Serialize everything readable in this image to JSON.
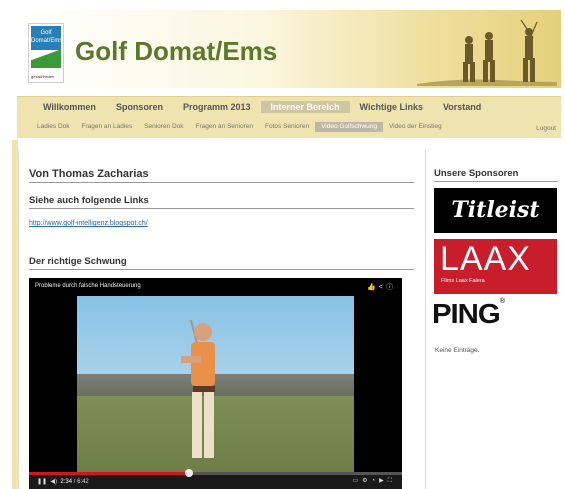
{
  "header": {
    "logo_top": "Golf Domat/Ems",
    "logo_sub": "gesall/Heden",
    "title": "Golf Domat/Ems"
  },
  "nav": {
    "main": [
      {
        "label": "Willkommen",
        "active": false
      },
      {
        "label": "Sponsoren",
        "active": false
      },
      {
        "label": "Programm 2013",
        "active": false
      },
      {
        "label": "Interner Bereich",
        "active": true
      },
      {
        "label": "Wichtige Links",
        "active": false
      },
      {
        "label": "Vorstand",
        "active": false
      }
    ],
    "sub": [
      {
        "label": "Ladies Dok",
        "active": false
      },
      {
        "label": "Fragen an Ladies",
        "active": false
      },
      {
        "label": "Senioren Dok",
        "active": false
      },
      {
        "label": "Fragen an Senioren",
        "active": false
      },
      {
        "label": "Fotos Senioren",
        "active": false
      },
      {
        "label": "Video Golfschwung",
        "active": true
      },
      {
        "label": "Video der Einstieg",
        "active": false
      }
    ],
    "logout": "Logout"
  },
  "main": {
    "heading": "Von Thomas Zacharias",
    "links_heading": "Siehe auch folgende Links",
    "link_text": "http://www.golf-intelligenz.blogspot.ch/",
    "swing_heading": "Der richtige Schwung",
    "video": {
      "title": "Probleme durch falsche Handsteuerung",
      "current_time": "2:34",
      "duration": "/ 6:42",
      "progress": 0.43
    }
  },
  "sidebar": {
    "title": "Unsere Sponsoren",
    "sponsors": [
      "Titleist",
      "LAAX",
      "Flims Laax Falera",
      "PING"
    ],
    "empty_text": "Keine Einträge."
  },
  "colors": {
    "title_green": "#5a7a2a",
    "nav_bg": "#efe3b0",
    "laax_red": "#c81d2a",
    "progress_red": "#cc181e"
  }
}
